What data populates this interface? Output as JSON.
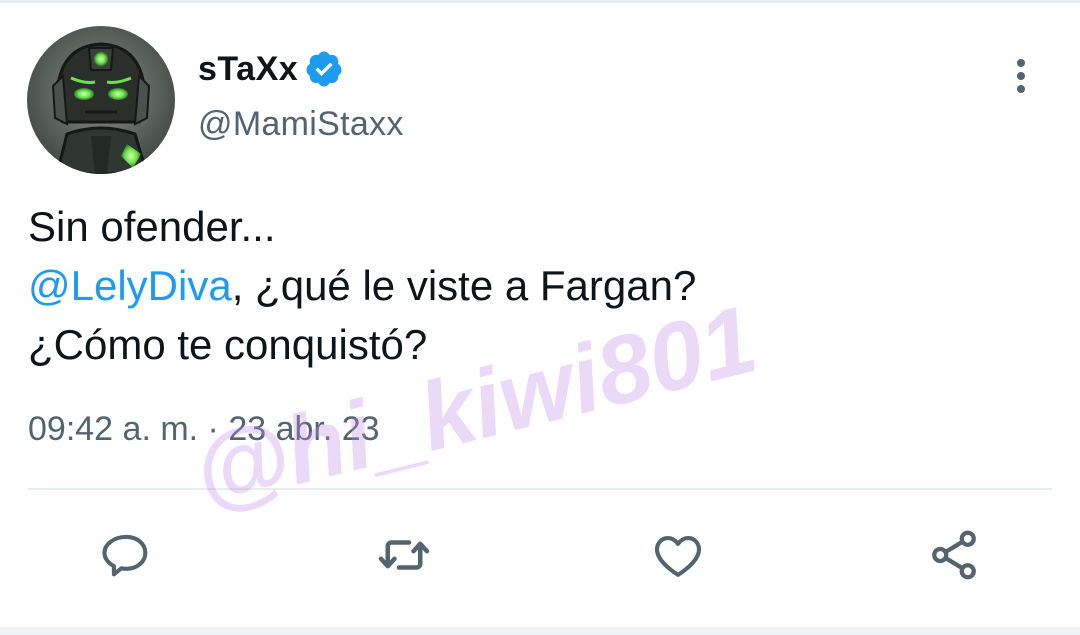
{
  "tweet": {
    "display_name": "sTaXx",
    "handle": "@MamiStaxx",
    "text_line1": "Sin ofender...",
    "mention": "@LelyDiva",
    "text_line2_rest": ", ¿qué le viste a Fargan?",
    "text_line3": "¿Cómo te conquistó?",
    "timestamp": "09:42 a. m. · 23 abr. 23"
  },
  "icons": {
    "verified": "verified-badge-icon",
    "more": "more-vertical-icon",
    "reply": "reply-icon",
    "retweet": "retweet-icon",
    "like": "heart-icon",
    "share": "share-icon"
  },
  "watermark": "@hi_kiwi801",
  "colors": {
    "text": "#0f1419",
    "secondary": "#536471",
    "accent": "#1d9bf0",
    "watermark": "#be8ce6"
  }
}
